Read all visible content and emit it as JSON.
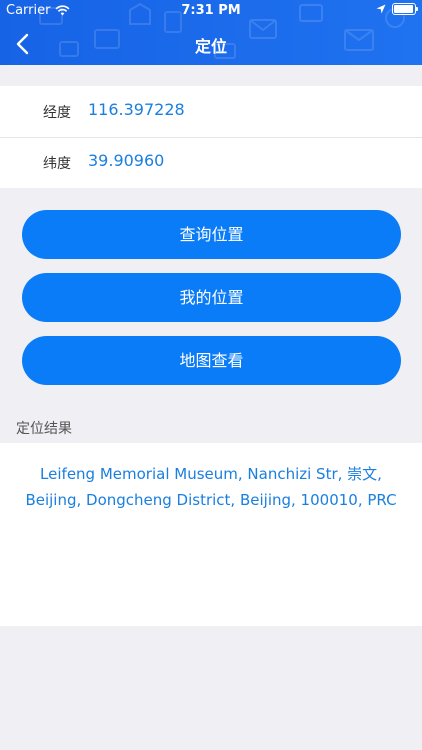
{
  "status_bar": {
    "carrier": "Carrier",
    "time": "7:31 PM",
    "battery_level": 0.95,
    "icons": [
      "wifi-icon",
      "location-arrow-icon",
      "battery-icon"
    ]
  },
  "nav": {
    "title": "定位",
    "back_icon": "chevron-left-icon"
  },
  "coordinates": {
    "longitude_label": "经度",
    "longitude_value": "116.397228",
    "latitude_label": "纬度",
    "latitude_value": "39.90960"
  },
  "buttons": {
    "query_location": "查询位置",
    "my_location": "我的位置",
    "map_view": "地图查看"
  },
  "result": {
    "section_label": "定位结果",
    "address": "Leifeng Memorial Museum, Nanchizi Str, 崇文, Beijing, Dongcheng District, Beijing, 100010, PRC"
  },
  "colors": {
    "header_blue": "#1a6bec",
    "button_blue": "#0a7cf7",
    "value_blue": "#1a7fe0",
    "background": "#efeff4"
  }
}
